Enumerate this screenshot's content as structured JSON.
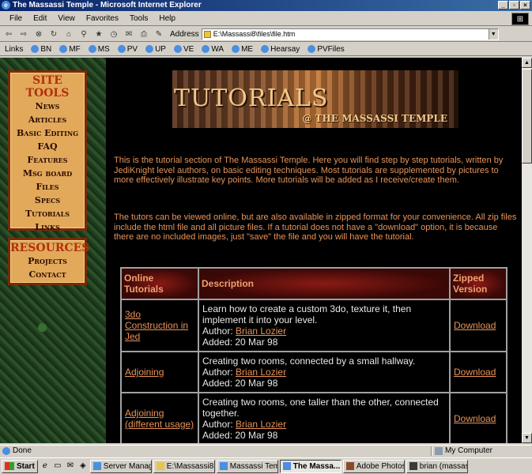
{
  "window": {
    "title": "The Massassi Temple - Microsoft Internet Explorer"
  },
  "menu": [
    "File",
    "Edit",
    "View",
    "Favorites",
    "Tools",
    "Help"
  ],
  "toolbar": {
    "address_label": "Address",
    "address_value": "E:\\Massassi8\\files\\file.htm"
  },
  "links_bar": {
    "label": "Links",
    "items": [
      "BN",
      "MF",
      "MS",
      "PV",
      "UP",
      "VE",
      "WA",
      "ME",
      "Hearsay",
      "PVFiles"
    ]
  },
  "sidebar": {
    "site_tools": {
      "heading": "Site Tools",
      "items": [
        "News",
        "Articles",
        "Basic Editing",
        "FAQ",
        "Features",
        "Msg board",
        "Files",
        "Specs",
        "Tutorials",
        "Links"
      ]
    },
    "resources": {
      "heading": "Resources",
      "items": [
        "Projects",
        "Contact"
      ]
    }
  },
  "banner": {
    "title": "Tutorials",
    "subtitle": "@ The Massassi Temple"
  },
  "intro": {
    "p1": "This is the tutorial section of The Massassi Temple. Here you will find step by step tutorials, written by JediKnight level authors, on basic editing techniques. Most tutorials are supplemented by pictures to more effectively illustrate key points. More tutorials will be added as I receive/create them.",
    "p2": "The tutors can be viewed online, but are also available in zipped format for your convenience. All zip files include the html file and all picture files. If a tutorial does not have a \"download\" option, it is because there are no included images, just \"save\" the file and you will have the tutorial."
  },
  "table": {
    "headers": [
      "Online Tutorials",
      "Description",
      "Zipped Version"
    ],
    "rows": [
      {
        "name": "3do Construction in Jed",
        "desc": "Learn how to create a custom 3do, texture it, then implement it into your level.",
        "author_label": "Author: ",
        "author": "Brian Lozier",
        "added": "Added: 20 Mar 98",
        "zip": "Download"
      },
      {
        "name": "Adjoining",
        "desc": "Creating two rooms, connected by a small hallway.",
        "author_label": "Author: ",
        "author": "Brian Lozier",
        "added": "Added: 20 Mar 98",
        "zip": "Download"
      },
      {
        "name": "Adjoining (different usage)",
        "desc": "Creating two rooms, one taller than the other, connected together.",
        "author_label": "Author: ",
        "author": "Brian Lozier",
        "added": "Added: 20 Mar 98",
        "zip": "Download"
      }
    ]
  },
  "status": {
    "left": "Done",
    "zone": "My Computer"
  },
  "taskbar": {
    "start": "Start",
    "tasks": [
      "Server Manag...",
      "E:\\Massassi8",
      "Massassi Tem...",
      "The Massa...",
      "Adobe Photos...",
      "brian (massas..."
    ],
    "active_index": 3
  }
}
